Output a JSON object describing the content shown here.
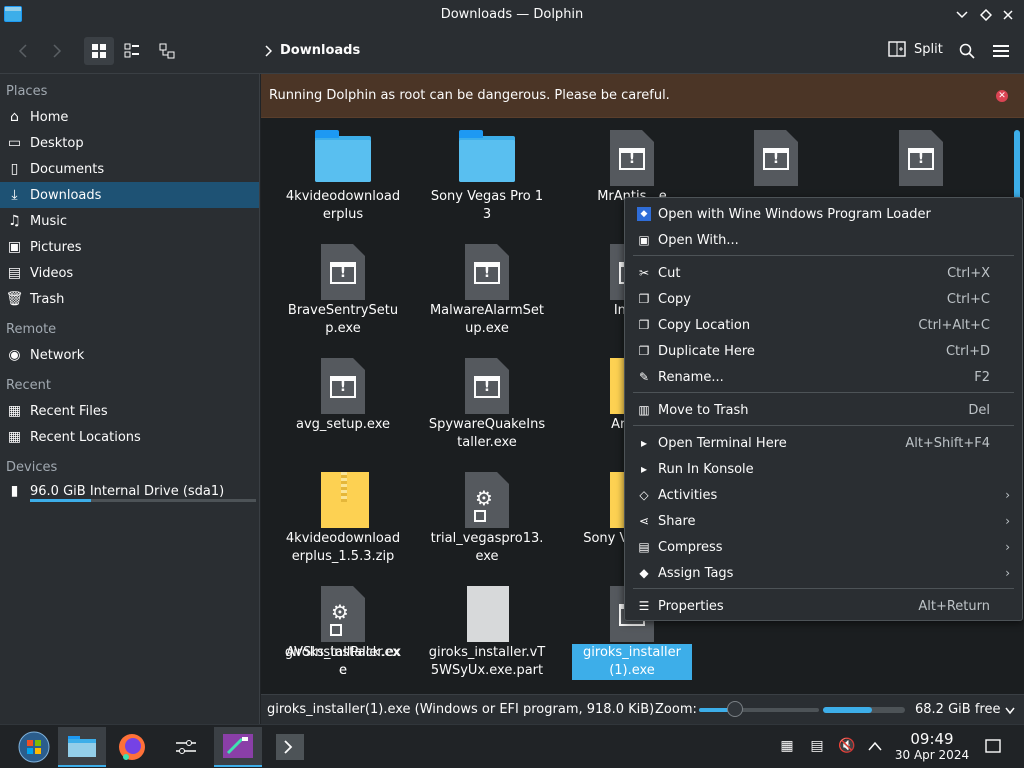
{
  "window": {
    "title": "Downloads — Dolphin"
  },
  "toolbar": {
    "breadcrumb": "Downloads",
    "split_label": "Split"
  },
  "sidebar": {
    "sections": {
      "places": "Places",
      "remote": "Remote",
      "recent": "Recent",
      "devices": "Devices"
    },
    "places": [
      "Home",
      "Desktop",
      "Documents",
      "Downloads",
      "Music",
      "Pictures",
      "Videos",
      "Trash"
    ],
    "remote": [
      "Network"
    ],
    "recent": [
      "Recent Files",
      "Recent Locations"
    ],
    "devices": [
      "96.0 GiB Internal Drive (sda1)"
    ],
    "drive_usage_fraction": 0.27
  },
  "banner": {
    "text": "Running Dolphin as root can be dangerous. Please be careful."
  },
  "files": [
    {
      "name": "4kvideodownloaderplus",
      "type": "folder"
    },
    {
      "name": "Sony Vegas Pro 13",
      "type": "folder"
    },
    {
      "name": "MrAntis...e",
      "type": "exe"
    },
    {
      "name": "",
      "type": "exe"
    },
    {
      "name": "",
      "type": "exe"
    },
    {
      "name": "BraveSentrySetup.exe",
      "type": "exe"
    },
    {
      "name": "MalwareAlarmSetup.exe",
      "type": "exe"
    },
    {
      "name": "Inst...",
      "type": "exe"
    },
    {
      "name": "avg_setup.exe",
      "type": "exe"
    },
    {
      "name": "SpywareQuakeInstaller.exe",
      "type": "exe"
    },
    {
      "name": "Arch...",
      "type": "zip"
    },
    {
      "name": "4kvideodownloaderplus_1.5.3.zip",
      "type": "zip"
    },
    {
      "name": "trial_vegaspro13.exe",
      "type": "exe-gear"
    },
    {
      "name": "Sony Veg... 1...",
      "type": "zip"
    },
    {
      "name": "AVSInstallPack.exe",
      "type": "exe"
    },
    {
      "name": "giroks_installer.exe",
      "type": "exe-gear"
    },
    {
      "name": "giroks_installer.vT5WSyUx.exe.part",
      "type": "part"
    },
    {
      "name": "giroks_installer(1).exe",
      "type": "exe",
      "selected": true
    }
  ],
  "context_menu": [
    {
      "label": "Open with Wine Windows Program Loader",
      "shortcut": "",
      "icon": "wine-icon"
    },
    {
      "label": "Open With...",
      "shortcut": "",
      "icon": "open-with-icon"
    },
    {
      "label": "Cut",
      "shortcut": "Ctrl+X",
      "icon": "scissors-icon"
    },
    {
      "label": "Copy",
      "shortcut": "Ctrl+C",
      "icon": "copy-icon"
    },
    {
      "label": "Copy Location",
      "shortcut": "Ctrl+Alt+C",
      "icon": "copy-location-icon"
    },
    {
      "label": "Duplicate Here",
      "shortcut": "Ctrl+D",
      "icon": "duplicate-icon"
    },
    {
      "label": "Rename...",
      "shortcut": "F2",
      "icon": "pencil-icon"
    },
    {
      "label": "Move to Trash",
      "shortcut": "Del",
      "icon": "trash-icon"
    },
    {
      "label": "Open Terminal Here",
      "shortcut": "Alt+Shift+F4",
      "icon": "terminal-icon"
    },
    {
      "label": "Run In Konsole",
      "shortcut": "",
      "icon": "konsole-icon"
    },
    {
      "label": "Activities",
      "shortcut": "",
      "icon": "activities-icon",
      "submenu": true
    },
    {
      "label": "Share",
      "shortcut": "",
      "icon": "share-icon",
      "submenu": true
    },
    {
      "label": "Compress",
      "shortcut": "",
      "icon": "compress-icon",
      "submenu": true
    },
    {
      "label": "Assign Tags",
      "shortcut": "",
      "icon": "tag-icon",
      "submenu": true
    },
    {
      "label": "Properties",
      "shortcut": "Alt+Return",
      "icon": "properties-icon"
    }
  ],
  "status": {
    "file_info": "giroks_installer(1).exe (Windows or EFI program, 918.0 KiB)",
    "zoom_label": "Zoom:",
    "zoom_fraction": 0.3,
    "free_label": "68.2 GiB free",
    "used_fraction": 0.6
  },
  "taskbar": {
    "time": "09:49",
    "date": "30 Apr 2024"
  },
  "colors": {
    "accent": "#3daee9",
    "warning_bg": "#4b3526",
    "close_red": "#da4453"
  }
}
